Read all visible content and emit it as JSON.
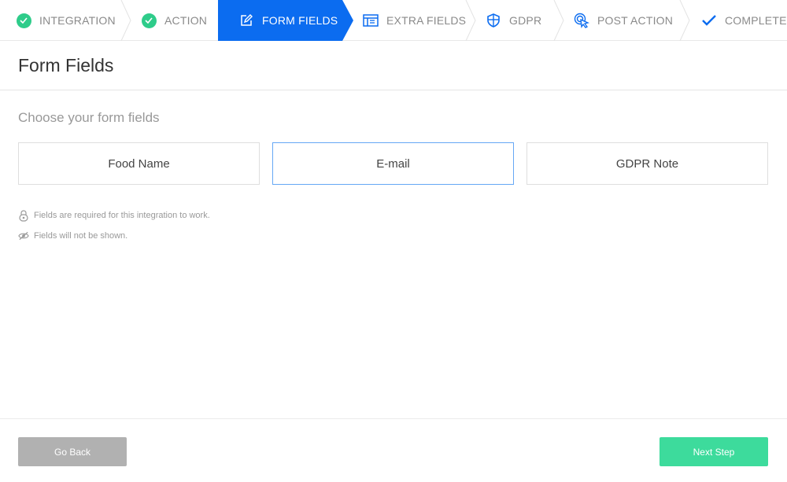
{
  "stepper": {
    "steps": [
      {
        "label": "INTEGRATION",
        "state": "done",
        "icon": "check-circle-icon"
      },
      {
        "label": "ACTION",
        "state": "done",
        "icon": "check-circle-icon"
      },
      {
        "label": "FORM FIELDS",
        "state": "active",
        "icon": "edit-icon"
      },
      {
        "label": "EXTRA FIELDS",
        "state": "pending",
        "icon": "form-list-icon"
      },
      {
        "label": "GDPR",
        "state": "pending",
        "icon": "shield-icon"
      },
      {
        "label": "POST ACTION",
        "state": "pending",
        "icon": "cursor-click-icon"
      },
      {
        "label": "COMPLETE",
        "state": "pending",
        "icon": "checkmark-icon"
      }
    ]
  },
  "header": {
    "title": "Form Fields"
  },
  "content": {
    "subtitle": "Choose your form fields",
    "fields": [
      {
        "label": "Food Name",
        "selected": false
      },
      {
        "label": "E-mail",
        "selected": true
      },
      {
        "label": "GDPR Note",
        "selected": false
      }
    ],
    "legend": [
      {
        "icon": "lock-icon",
        "text": "Fields are required for this integration to work."
      },
      {
        "icon": "eye-slash-icon",
        "text": "Fields will not be shown."
      }
    ]
  },
  "footer": {
    "back_label": "Go Back",
    "next_label": "Next Step"
  },
  "colors": {
    "active": "#0b6cf0",
    "done": "#2ecc8a",
    "next": "#3ddb9c",
    "back": "#b1b1b1",
    "selected_border": "#66a8f5"
  }
}
